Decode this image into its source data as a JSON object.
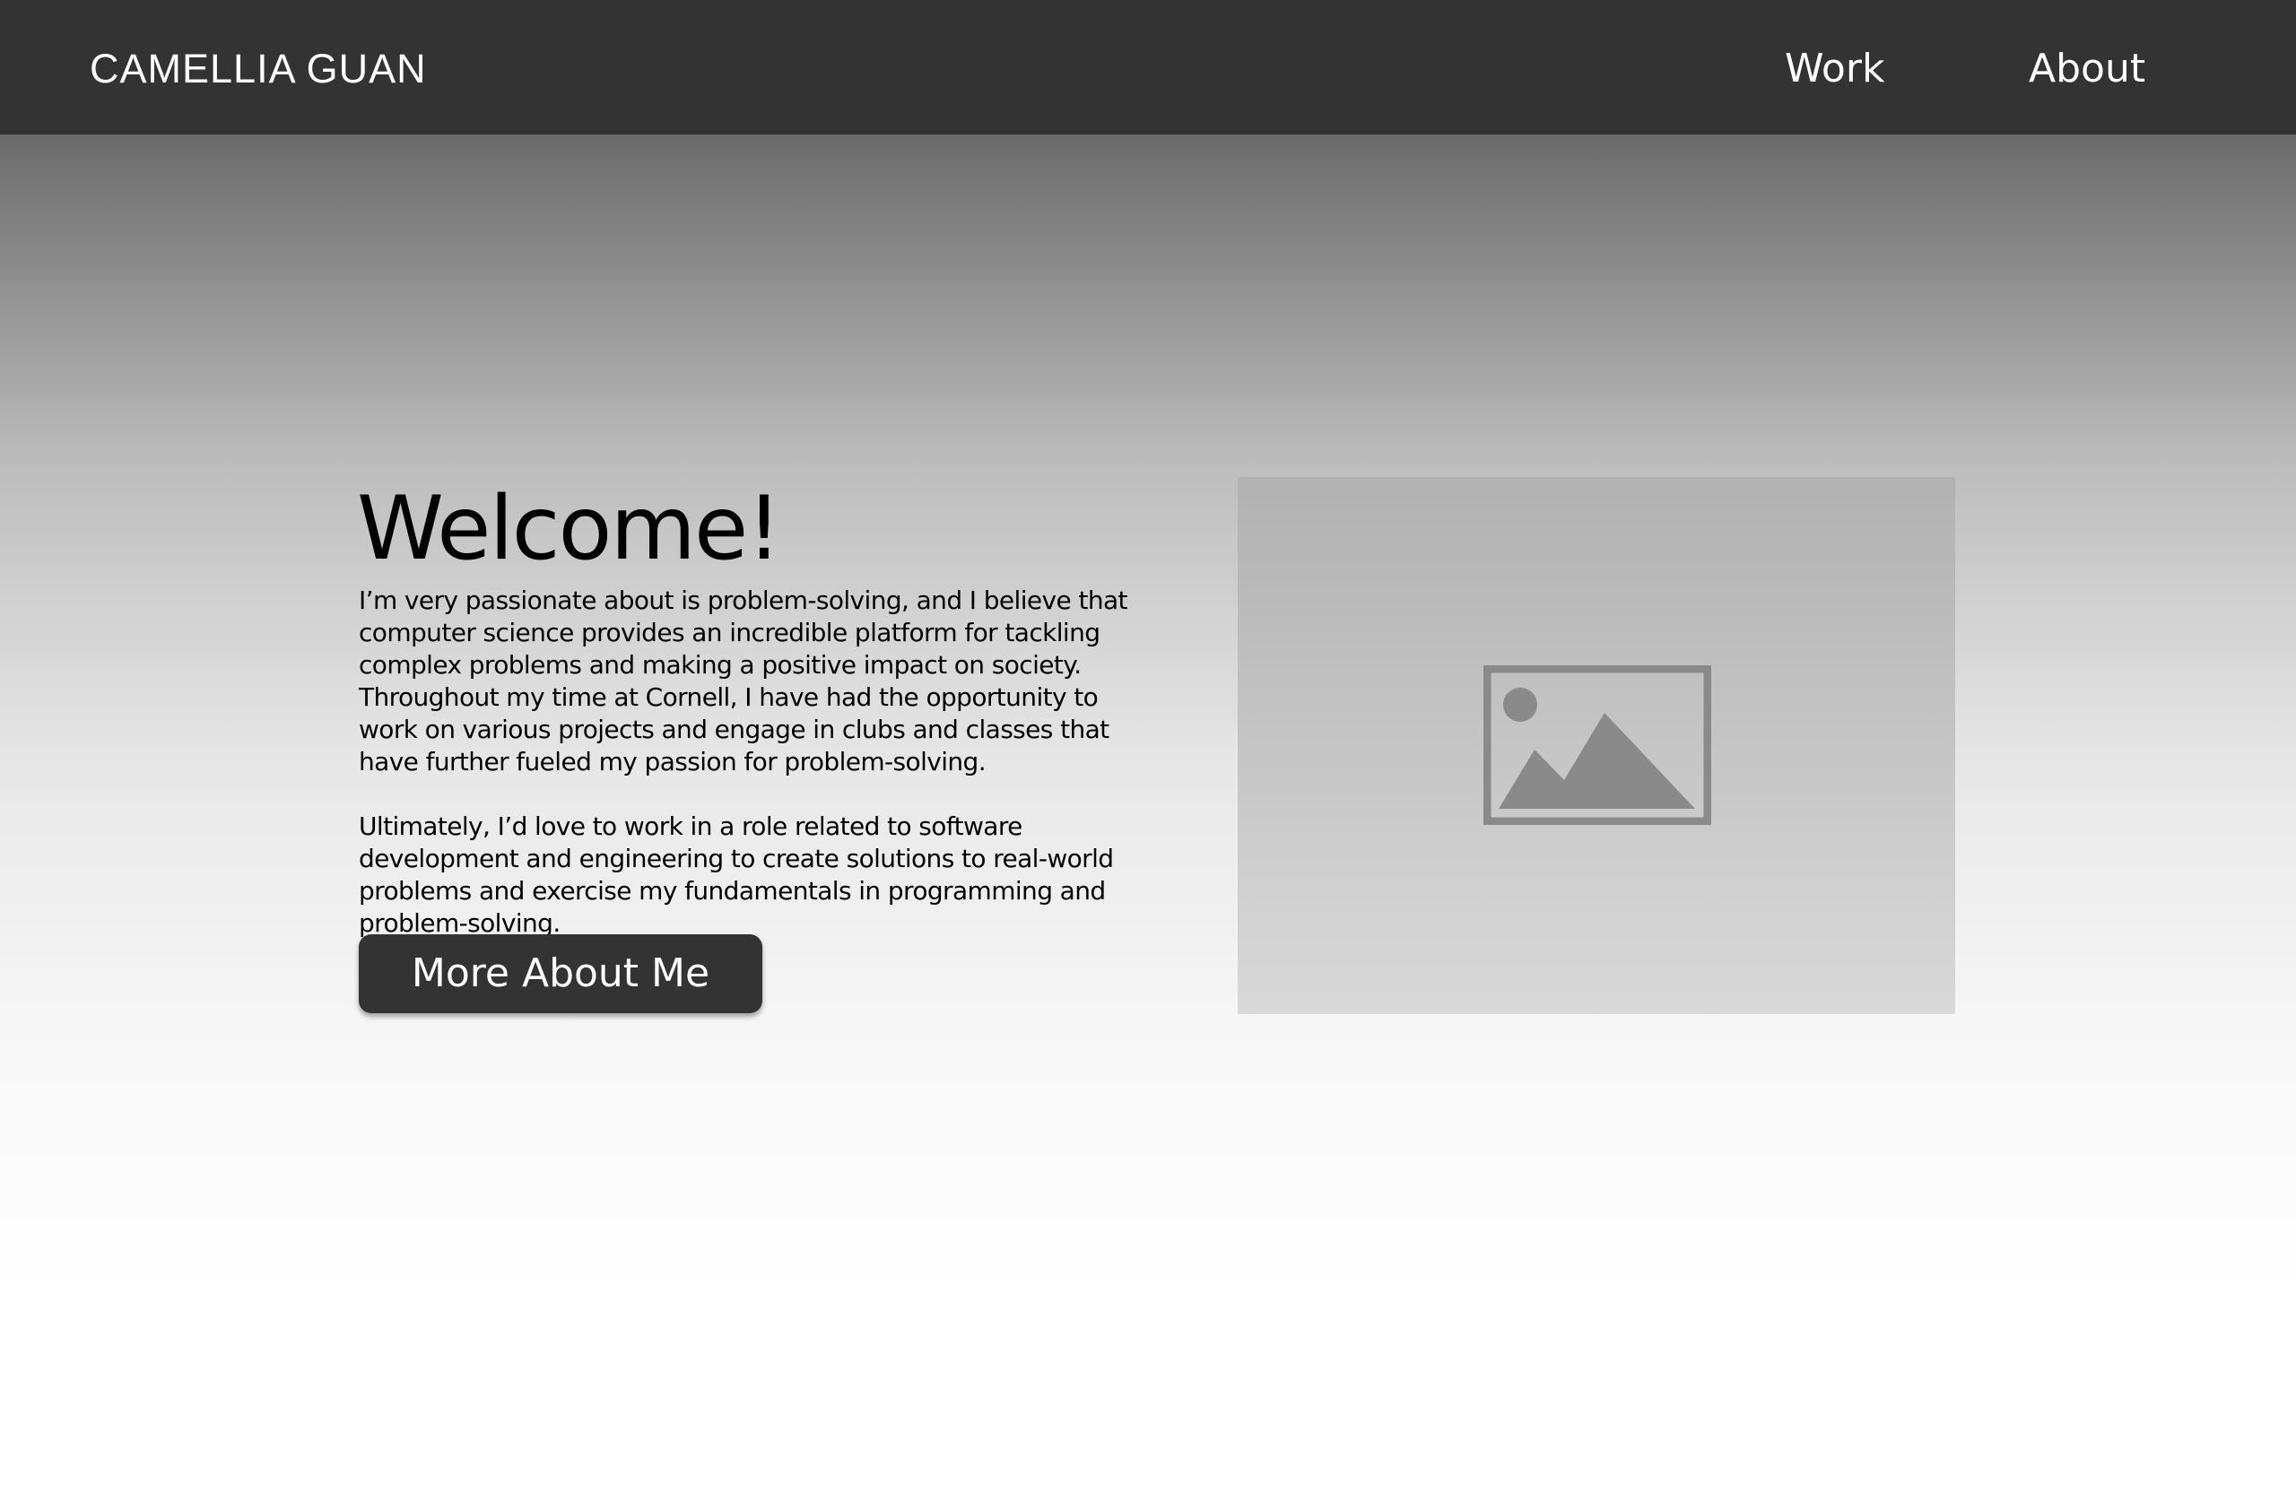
{
  "header": {
    "brand": "CAMELLIA GUAN",
    "nav": [
      {
        "label": "Work"
      },
      {
        "label": "About"
      }
    ]
  },
  "hero": {
    "title": "Welcome!",
    "paragraphs": [
      "I’m very passionate about is problem-solving, and I believe that computer science provides an incredible platform for tackling complex problems and making a positive impact on society. Throughout my time at Cornell, I have had the opportunity to work on various projects and engage in clubs and classes that have further fueled my passion for problem-solving.",
      "Ultimately, I’d love to work in a role related to software development and engineering to create solutions to real-world problems and exercise my fundamentals in programming and problem-solving."
    ],
    "button_label": "More About Me",
    "image_icon": "image-placeholder-icon"
  },
  "colors": {
    "navbar_bg": "#333333",
    "button_bg": "#333333",
    "nav_text": "#ffffff",
    "placeholder_icon": "#8a8a8a"
  }
}
